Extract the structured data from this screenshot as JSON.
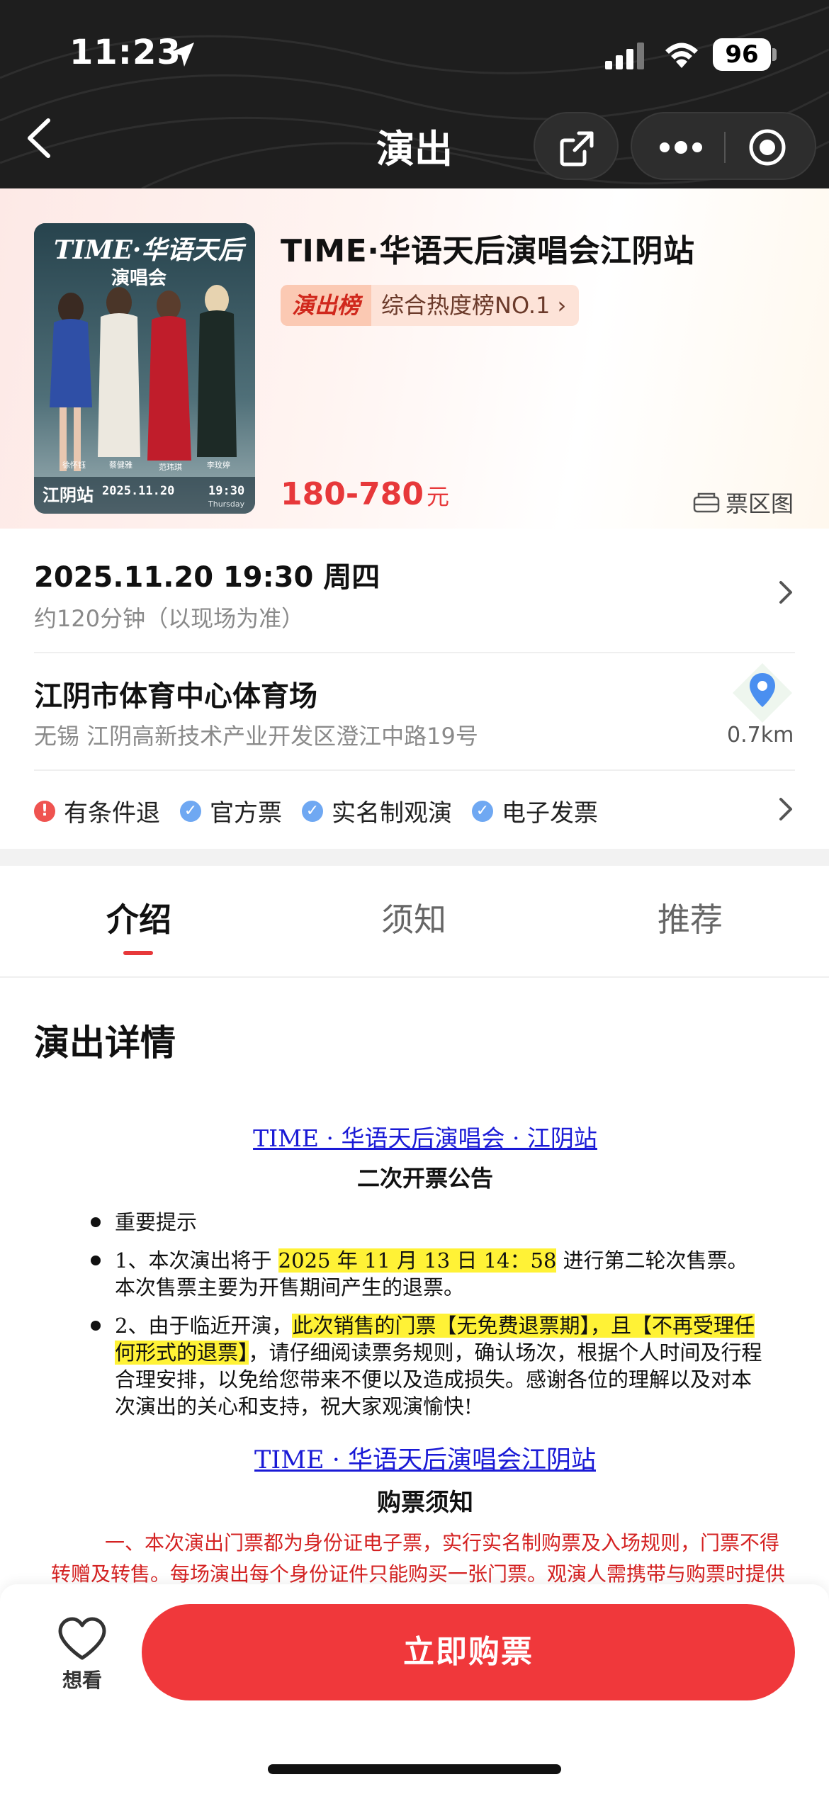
{
  "status_bar": {
    "time": "11:23",
    "battery": "96"
  },
  "nav": {
    "title": "演出"
  },
  "show": {
    "title": "TIME·华语天后演唱会江阴站",
    "rank_label": "演出榜",
    "rank_text": "综合热度榜NO.1 ›",
    "price_range": "180-780",
    "price_unit": "元",
    "seat_map_label": "票区图",
    "poster": {
      "headline": "TIME·华语天后",
      "subheadline": "演唱会",
      "city": "江阴站",
      "date": "2025.11.20",
      "time": "19:30",
      "weekday": "Thursday",
      "names": [
        "徐怀钰",
        "蔡健雅",
        "范玮琪",
        "李玟婷"
      ]
    }
  },
  "schedule": {
    "datetime": "2025.11.20 19:30 周四",
    "duration": "约120分钟（以现场为准）"
  },
  "venue": {
    "name": "江阴市体育中心体育场",
    "address": "无锡 江阴高新技术产业开发区澄江中路19号",
    "distance": "0.7km"
  },
  "tags": [
    {
      "label": "有条件退",
      "color": "#ef5350",
      "icon": "exclamation-icon"
    },
    {
      "label": "官方票",
      "color": "#6fa8f2",
      "icon": "check-icon"
    },
    {
      "label": "实名制观演",
      "color": "#6fa8f2",
      "icon": "check-icon"
    },
    {
      "label": "电子发票",
      "color": "#6fa8f2",
      "icon": "check-icon"
    }
  ],
  "tabs": [
    {
      "label": "介绍",
      "active": true
    },
    {
      "label": "须知",
      "active": false
    },
    {
      "label": "推荐",
      "active": false
    }
  ],
  "details": {
    "section_title": "演出详情",
    "notice1_link": "TIME · 华语天后演唱会 · 江阴站",
    "notice1_sub": "二次开票公告",
    "bullet1": "重要提示",
    "bullet2_prefix": "1、本次演出将于 ",
    "bullet2_highlight": "2025 年 11 月 13 日 14：58",
    "bullet2_suffix": " 进行第二轮次售票。本次售票主要为开售期间产生的退票。",
    "bullet3_prefix": "2、由于临近开演，",
    "bullet3_highlight": "此次销售的门票【无免费退票期】，且【不再受理任何形式的退票】",
    "bullet3_suffix": "，请仔细阅读票务规则，确认场次，根据个人时间及行程合理安排，以免给您带来不便以及造成损失。感谢各位的理解以及对本次演出的关心和支持，祝大家观演愉快!",
    "notice2_link": "TIME · 华语天后演唱会江阴站",
    "notice2_sub": "购票须知",
    "red_paragraph": "一、本次演出门票都为身份证电子票，实行实名制购票及入场规则，门票不得转赠及转售。每场演出每个身份证件只能购买一张门票。观演人需携带与购票时提供的"
  },
  "bottom_bar": {
    "want_label": "想看",
    "buy_label": "立即购票",
    "buy_color": "#f0383b"
  }
}
